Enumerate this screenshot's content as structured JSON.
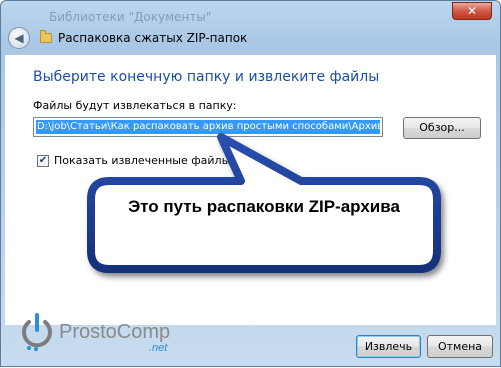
{
  "window": {
    "background_title": "Библиотеки \"Документы\"",
    "close_label": "✕",
    "nav_title": "Распаковка сжатых ZIP-папок"
  },
  "main": {
    "heading": "Выберите конечную папку и извлеките файлы",
    "path_label": "Файлы будут извлекаться в папку:",
    "path_value": "D:\\job\\Статьи\\Как распаковать архив простыми способами\\Архив\\Чек-лист",
    "browse_label": "Обзор...",
    "show_files_label": "Показать извлеченные файлы",
    "show_files_checked": true
  },
  "callout": {
    "text": "Это путь распаковки ZIP-архива"
  },
  "logo": {
    "text": "ProstoComp",
    "suffix": ".net"
  },
  "footer": {
    "extract_label": "Извлечь",
    "cancel_label": "Отмена"
  },
  "colors": {
    "heading": "#1b4fa3",
    "selection": "#3399ff",
    "callout_fill": "#1e3f9b"
  }
}
